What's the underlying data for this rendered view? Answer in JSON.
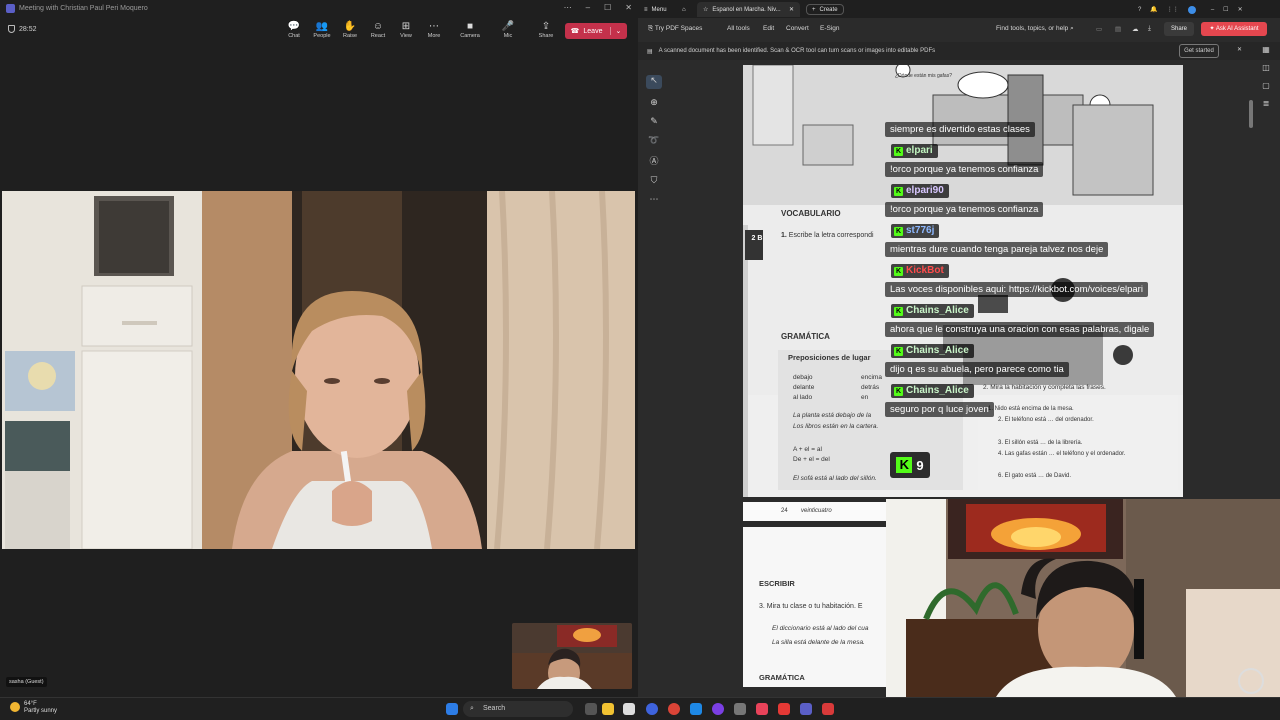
{
  "teams": {
    "title": "Meeting with Christian Paul Peri Moquero",
    "timer": "28:52",
    "toolbar": [
      {
        "label": "Chat",
        "icon": "chat-icon",
        "glyph": "💬"
      },
      {
        "label": "People",
        "icon": "people-icon",
        "glyph": "👥"
      },
      {
        "label": "Raise",
        "icon": "raise-hand-icon",
        "glyph": "✋"
      },
      {
        "label": "React",
        "icon": "react-icon",
        "glyph": "☺"
      },
      {
        "label": "View",
        "icon": "view-icon",
        "glyph": "⊞"
      },
      {
        "label": "More",
        "icon": "more-icon",
        "glyph": "⋯"
      },
      {
        "label": "Camera",
        "icon": "camera-icon",
        "glyph": "■"
      },
      {
        "label": "Mic",
        "icon": "mic-icon",
        "glyph": "🎤"
      },
      {
        "label": "Share",
        "icon": "share-icon",
        "glyph": "⇪"
      }
    ],
    "leave_label": "Leave",
    "guest_label": "sasha (Guest)"
  },
  "edge": {
    "tabs": {
      "menu": "Menu",
      "active": "Espanol en Marcha. Niv...",
      "create": "Create"
    },
    "pdf_toolbar": {
      "spaces": "Try PDF Spaces",
      "all_tools": "All tools",
      "edit": "Edit",
      "convert": "Convert",
      "esign": "E-Sign",
      "find": "Find tools, topics, or help",
      "share": "Share",
      "ai": "Ask AI Assistant"
    },
    "banner": {
      "text": "A scanned document has been identified. Scan & OCR tool can turn scans or images into editable PDFs",
      "button": "Get started"
    }
  },
  "pdf_page": {
    "speech": "¿Dónde están mis gafas?",
    "vocab": "VOCABULARIO",
    "ex1_num": "1.",
    "ex1": "Escribe la letra correspondi",
    "grammar": "GRAMÁTICA",
    "prep_title": "Preposiciones de lugar",
    "preps": [
      "debajo",
      "delante",
      "al lado",
      "encima",
      "detrás",
      "en"
    ],
    "prep_examples": [
      "La planta está debajo de la",
      "Los libros están en la cartera."
    ],
    "contractions": [
      "A + el = al",
      "De + el = del"
    ],
    "sofa": "El sofá está al lado del sillón.",
    "ex2": "2. Mira la habitación y completa las frases.",
    "sentences": [
      "1. Nido está encima de la mesa.",
      "2. El teléfono está … del ordenador.",
      "3. El sillón está … de la librería.",
      "4. Las gafas están … el teléfono y el ordenador.",
      "6. El gato está … de David."
    ],
    "page_num": "24",
    "page_word": "veinticuatro",
    "side_tab": "2 B",
    "escribir": "ESCRIBIR",
    "ex3": "3. Mira tu clase o tu habitación. E",
    "p2_lines": [
      "El diccionario está al lado del cua",
      "La silla está delante de la mesa."
    ],
    "grammar2": "GRAMÁTICA"
  },
  "chat": [
    {
      "type": "line",
      "text": "siempre es divertido estas clases"
    },
    {
      "type": "user",
      "name": "elpari",
      "color": "#c1f5c0"
    },
    {
      "type": "line",
      "text": "!orco porque ya tenemos confianza"
    },
    {
      "type": "user",
      "name": "elpari90",
      "color": "#d8c7ff"
    },
    {
      "type": "line",
      "text": "!orco porque ya tenemos confianza"
    },
    {
      "type": "user",
      "name": "st776j",
      "color": "#8db8ff"
    },
    {
      "type": "line",
      "text": "mientras dure cuando tenga pareja talvez nos deje"
    },
    {
      "type": "user",
      "name": "KickBot",
      "color": "#ff4b4b"
    },
    {
      "type": "line",
      "text": "Las voces disponibles aqui: https://kickbot.com/voices/elpari"
    },
    {
      "type": "user",
      "name": "Chains_Alice",
      "color": "#c9f5c9"
    },
    {
      "type": "line",
      "text": "ahora que le construya una oracion con esas palabras, digale"
    },
    {
      "type": "user",
      "name": "Chains_Alice",
      "color": "#c9f5c9"
    },
    {
      "type": "line",
      "text": "dijo q es su abuela, pero parece como tia"
    },
    {
      "type": "user",
      "name": "Chains_Alice",
      "color": "#c9f5c9"
    },
    {
      "type": "line",
      "text": "seguro por q luce joven"
    }
  ],
  "kick_count": "9",
  "taskbar": {
    "temp": "64°F",
    "weather": "Partly sunny",
    "search": "Search"
  }
}
